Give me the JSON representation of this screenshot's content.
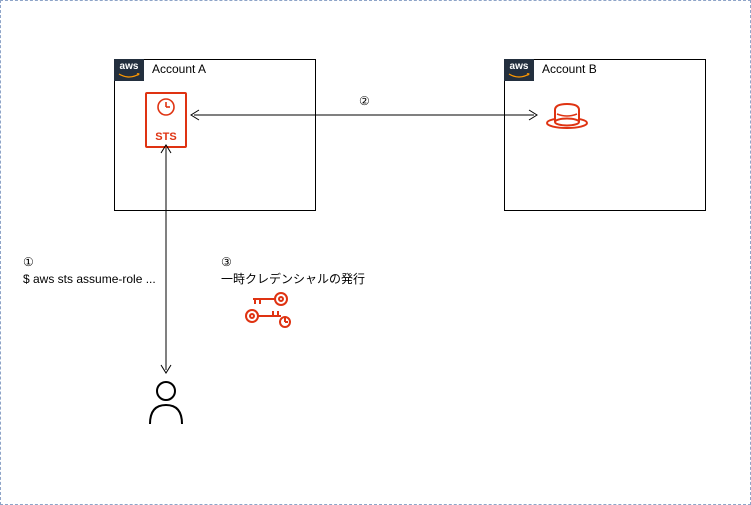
{
  "accounts": {
    "a": {
      "label": "Account A",
      "aws_text": "aws"
    },
    "b": {
      "label": "Account B",
      "aws_text": "aws"
    }
  },
  "sts": {
    "label": "STS"
  },
  "steps": {
    "one": {
      "num": "①",
      "text": "$ aws sts assume-role ..."
    },
    "two": {
      "num": "②"
    },
    "three": {
      "num": "③",
      "text": "一時クレデンシャルの発行"
    }
  },
  "icons": {
    "sts_clock": "sts-clock-icon",
    "role": "iam-role-icon",
    "user": "user-icon",
    "credentials": "temporary-credentials-icon"
  }
}
